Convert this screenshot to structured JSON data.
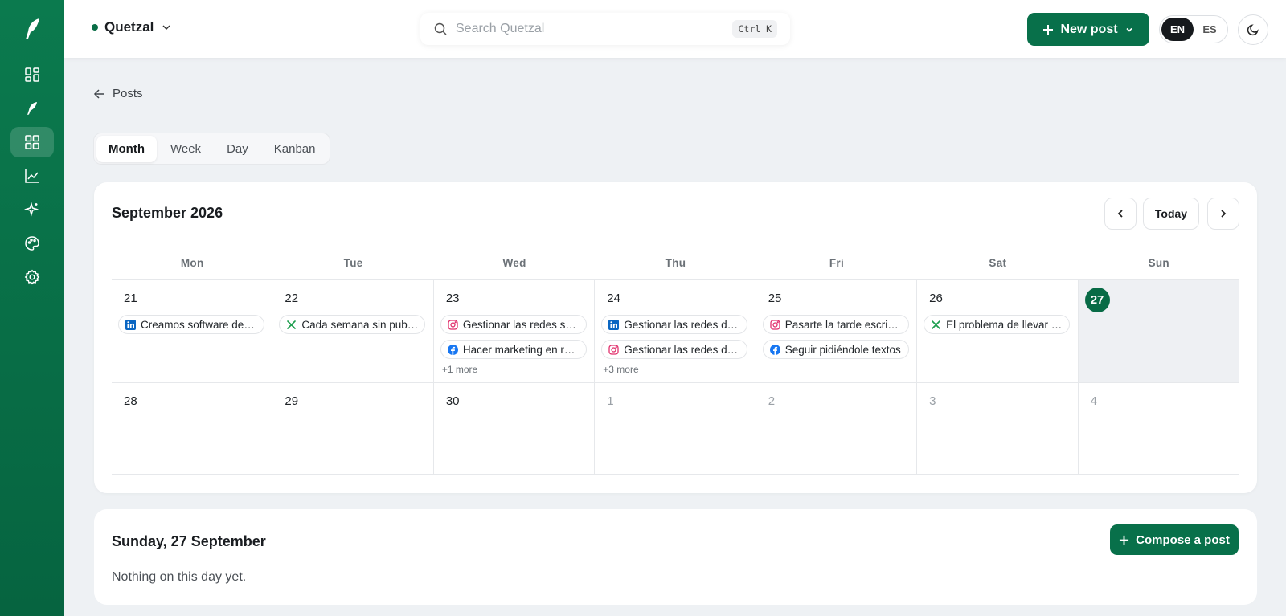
{
  "app": {
    "workspace": "Quetzal"
  },
  "search": {
    "placeholder": "Search Quetzal",
    "shortcut": "Ctrl K"
  },
  "header": {
    "new_post": "New post",
    "lang_en": "EN",
    "lang_es": "ES"
  },
  "breadcrumb": {
    "back": "Posts"
  },
  "tabs": [
    "Month",
    "Week",
    "Day",
    "Kanban"
  ],
  "calendar": {
    "title": "September 2026",
    "today_label": "Today",
    "weekdays": [
      "Mon",
      "Tue",
      "Wed",
      "Thu",
      "Fri",
      "Sat",
      "Sun"
    ],
    "weeks": [
      [
        {
          "day": "21",
          "posts": [
            {
              "net": "linkedin",
              "text": "Creamos software de la nada"
            }
          ]
        },
        {
          "day": "22",
          "posts": [
            {
              "net": "x",
              "text": "Cada semana sin publicar"
            }
          ]
        },
        {
          "day": "23",
          "posts": [
            {
              "net": "instagram",
              "text": "Gestionar las redes sociales"
            },
            {
              "net": "facebook",
              "text": "Hacer marketing en redes"
            }
          ],
          "more": "+1 more"
        },
        {
          "day": "24",
          "posts": [
            {
              "net": "linkedin",
              "text": "Gestionar las redes de tu marca"
            },
            {
              "net": "instagram",
              "text": "Gestionar las redes de tu marca"
            }
          ],
          "more": "+3 more"
        },
        {
          "day": "25",
          "posts": [
            {
              "net": "instagram",
              "text": "Pasarte la tarde escribiendo"
            },
            {
              "net": "facebook",
              "text": "Seguir pidiéndole textos"
            }
          ]
        },
        {
          "day": "26",
          "posts": [
            {
              "net": "x",
              "text": "El problema de llevar las redes"
            }
          ]
        },
        {
          "day": "27",
          "today": true,
          "posts": []
        }
      ],
      [
        {
          "day": "28",
          "posts": []
        },
        {
          "day": "29",
          "posts": []
        },
        {
          "day": "30",
          "posts": []
        },
        {
          "day": "1",
          "muted": true,
          "posts": []
        },
        {
          "day": "2",
          "muted": true,
          "posts": []
        },
        {
          "day": "3",
          "muted": true,
          "posts": []
        },
        {
          "day": "4",
          "muted": true,
          "posts": []
        }
      ]
    ]
  },
  "day_panel": {
    "title": "Sunday, 27 September",
    "empty": "Nothing on this day yet.",
    "compose": "Compose a post"
  },
  "colors": {
    "brand": "#08704a",
    "linkedin": "#0a66c2",
    "x": "#1d9e4e",
    "instagram": "#e1306c",
    "facebook": "#1877f2"
  }
}
